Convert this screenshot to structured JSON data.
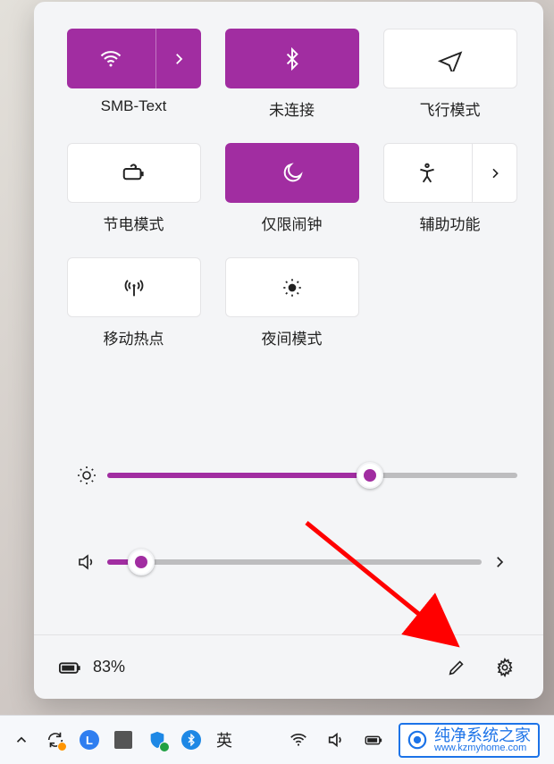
{
  "accent": "#a12da1",
  "tiles": [
    {
      "id": "wifi",
      "label": "SMB-Text",
      "state": "on",
      "split": true,
      "icon": "wifi-icon"
    },
    {
      "id": "bluetooth",
      "label": "未连接",
      "state": "on",
      "split": false,
      "icon": "bluetooth-icon"
    },
    {
      "id": "airplane",
      "label": "飞行模式",
      "state": "off",
      "split": false,
      "icon": "airplane-icon"
    },
    {
      "id": "battery-saver",
      "label": "节电模式",
      "state": "off",
      "split": false,
      "icon": "battery-saver-icon"
    },
    {
      "id": "focus",
      "label": "仅限闹钟",
      "state": "on",
      "split": false,
      "icon": "moon-icon"
    },
    {
      "id": "accessibility",
      "label": "辅助功能",
      "state": "off",
      "split": true,
      "icon": "accessibility-icon"
    },
    {
      "id": "hotspot",
      "label": "移动热点",
      "state": "off",
      "split": false,
      "icon": "hotspot-icon"
    },
    {
      "id": "nightlight",
      "label": "夜间模式",
      "state": "off",
      "split": false,
      "icon": "nightlight-icon"
    }
  ],
  "sliders": {
    "brightness": {
      "percent": 64
    },
    "volume": {
      "percent": 9
    }
  },
  "battery": {
    "text": "83%"
  },
  "taskbar": {
    "ime": "英"
  },
  "watermark": {
    "title": "纯净系统之家",
    "sub": "www.kzmyhome.com"
  }
}
